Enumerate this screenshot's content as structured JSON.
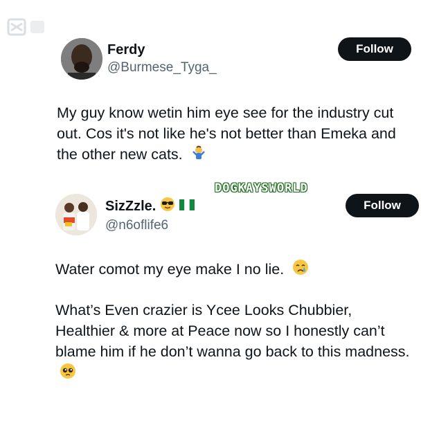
{
  "tweets": [
    {
      "display_name": "Ferdy",
      "handle": "@Burmese_Tyga_",
      "follow_label": "Follow",
      "text": "My guy know wetin him eye see for the industry cut out. Cos it's not like he's not better than Emeka and the other new cats.",
      "emoji": "person-shrugging-icon"
    },
    {
      "display_name": "SizZzle.",
      "handle": "@n6oflife6",
      "follow_label": "Follow",
      "badges": [
        "sunglasses-emoji-icon",
        "nigeria-flag-icon"
      ],
      "paragraphs": [
        "Water comot my eye make I no lie.",
        "What’s Even crazier is Ycee Looks Chubbier, Healthier & more at Peace now so I honestly can’t blame him if he don’t wanna go back to this madness."
      ],
      "emojis": [
        "crying-face-icon",
        "pleading-face-icon"
      ]
    }
  ],
  "watermark": "DOGKAYSWORLD"
}
